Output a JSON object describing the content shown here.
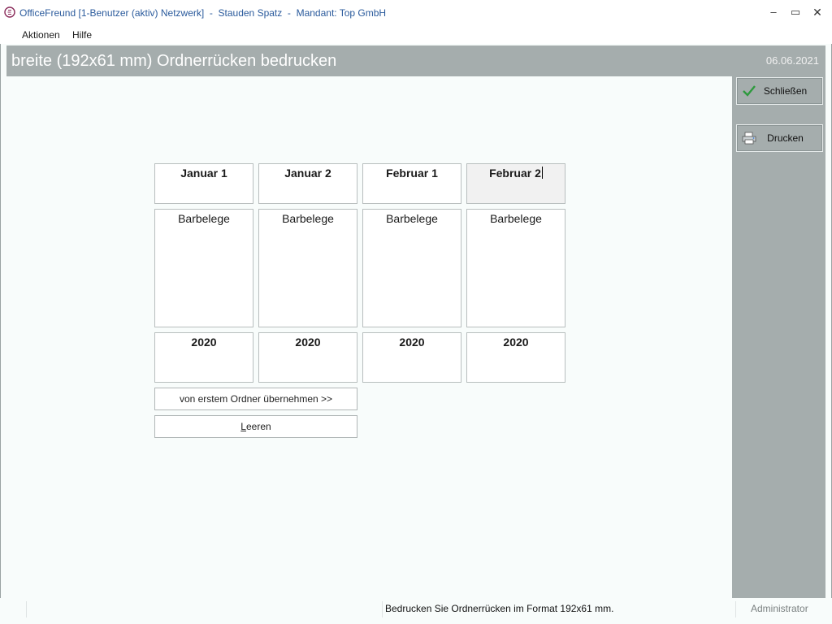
{
  "window": {
    "title": "OfficeFreund [1-Benutzer (aktiv) Netzwerk]  -  Stauden Spatz  -  Mandant: Top GmbH",
    "minimize_glyph": "–",
    "maximize_glyph": "▭",
    "close_glyph": "✕"
  },
  "menu": {
    "items": [
      {
        "label": "Aktionen"
      },
      {
        "label": "Hilfe"
      }
    ]
  },
  "header": {
    "title": "breite (192x61 mm) Ordnerrücken bedrucken",
    "date": "06.06.2021"
  },
  "sidebar": {
    "close_label": "Schließen",
    "close_icon": "checkmark-icon",
    "print_label": "Drucken",
    "print_icon": "printer-icon"
  },
  "folders": [
    {
      "month": "Januar 1",
      "description": "Barbelege",
      "year": "2020"
    },
    {
      "month": "Januar 2",
      "description": "Barbelege",
      "year": "2020"
    },
    {
      "month": "Februar 1",
      "description": "Barbelege",
      "year": "2020"
    },
    {
      "month": "Februar 2",
      "description": "Barbelege",
      "year": "2020"
    }
  ],
  "actions": {
    "copy_label": "von erstem Ordner übernehmen >>",
    "clear_label": "Leeren"
  },
  "status": {
    "message": "Bedrucken Sie Ordnerrücken im Format 192x61 mm.",
    "user": "Administrator"
  },
  "colors": {
    "accent_check": "#2e9a3e",
    "header_bg": "#a5adad",
    "title_text": "#2a5a9c"
  }
}
